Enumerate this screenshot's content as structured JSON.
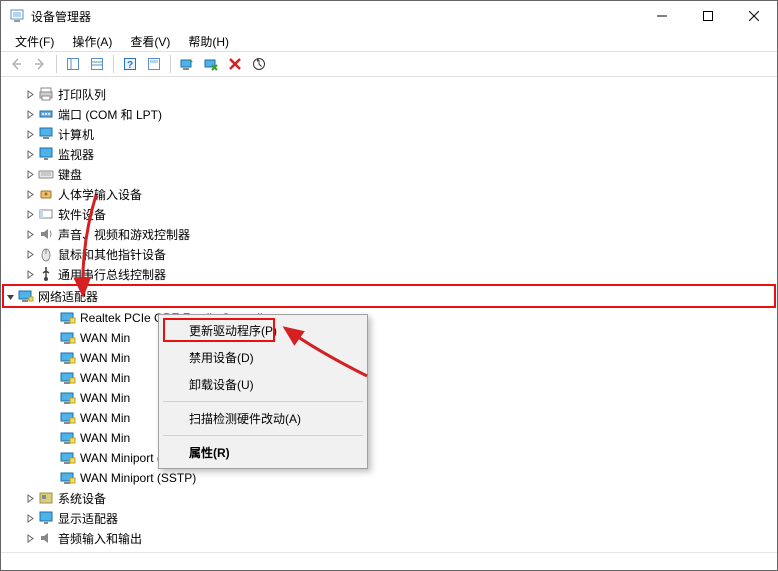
{
  "titlebar": {
    "title": "设备管理器"
  },
  "menubar": {
    "items": [
      {
        "label": "文件(F)"
      },
      {
        "label": "操作(A)"
      },
      {
        "label": "查看(V)"
      },
      {
        "label": "帮助(H)"
      }
    ]
  },
  "tree": {
    "categories": [
      {
        "name": "打印队列",
        "icon": "printer"
      },
      {
        "name": "端口 (COM 和 LPT)",
        "icon": "port"
      },
      {
        "name": "计算机",
        "icon": "computer"
      },
      {
        "name": "监视器",
        "icon": "monitor"
      },
      {
        "name": "键盘",
        "icon": "keyboard"
      },
      {
        "name": "人体学输入设备",
        "icon": "hid"
      },
      {
        "name": "软件设备",
        "icon": "software"
      },
      {
        "name": "声音、视频和游戏控制器",
        "icon": "audio"
      },
      {
        "name": "鼠标和其他指针设备",
        "icon": "mouse"
      },
      {
        "name": "通用串行总线控制器",
        "icon": "usb"
      }
    ],
    "network": {
      "name": "网络适配器",
      "icon": "network",
      "children": [
        "Realtek PCIe GBE Family Controller",
        "WAN Min",
        "WAN Min",
        "WAN Min",
        "WAN Min",
        "WAN Min",
        "WAN Min",
        "WAN Miniport (PPTP)",
        "WAN Miniport (SSTP)"
      ]
    },
    "after": [
      {
        "name": "系统设备",
        "icon": "system"
      },
      {
        "name": "显示适配器",
        "icon": "display"
      },
      {
        "name": "音频输入和输出",
        "icon": "audioio"
      }
    ]
  },
  "contextMenu": {
    "items": [
      {
        "label": "更新驱动程序(P)",
        "highlighted": true
      },
      {
        "label": "禁用设备(D)"
      },
      {
        "label": "卸载设备(U)"
      },
      {
        "sep": true
      },
      {
        "label": "扫描检测硬件改动(A)"
      },
      {
        "sep": true
      },
      {
        "label": "属性(R)",
        "bold": true
      }
    ]
  }
}
